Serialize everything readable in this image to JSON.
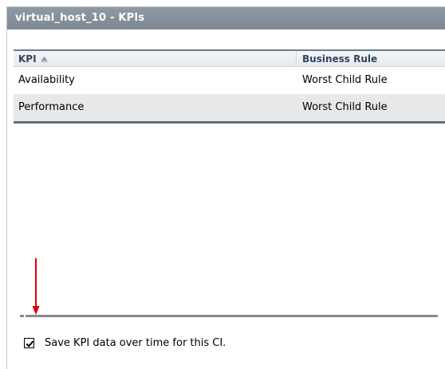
{
  "panel": {
    "title": "virtual_host_10 - KPIs"
  },
  "table": {
    "columns": [
      "KPI",
      "Business Rule"
    ],
    "sort": {
      "column": "KPI",
      "direction": "ascending"
    },
    "rows": [
      {
        "kpi": "Availability",
        "rule": "Worst Child Rule"
      },
      {
        "kpi": "Performance",
        "rule": "Worst Child Rule"
      }
    ]
  },
  "options": {
    "save_kpi_label": "Save KPI data over time for this CI.",
    "save_kpi_checked": true
  },
  "colors": {
    "title_bar": "#8e9aa5",
    "header_text": "#2f4660",
    "annotation_arrow": "#e00000"
  }
}
